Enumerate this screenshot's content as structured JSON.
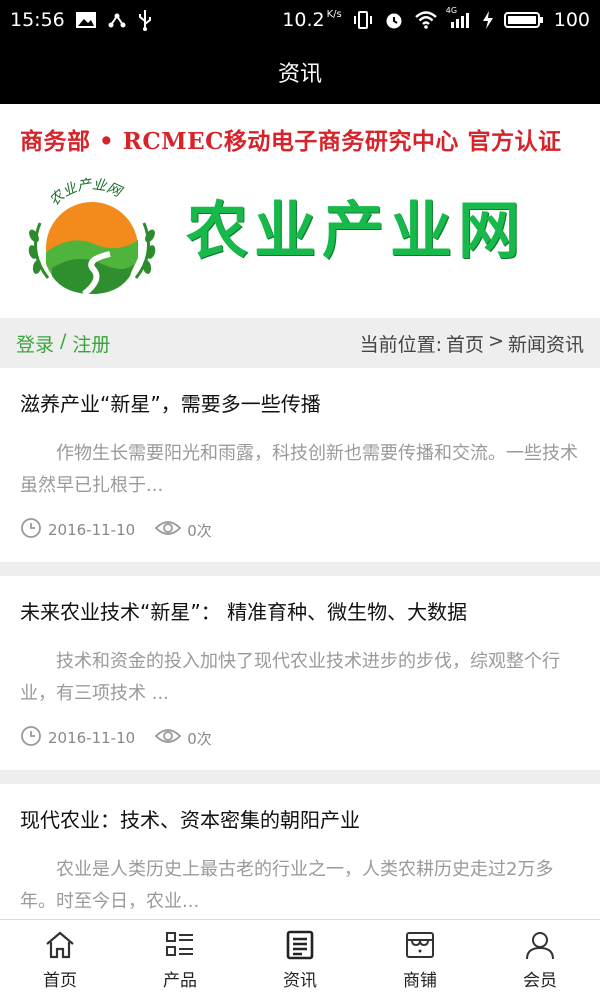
{
  "status_bar": {
    "time": "15:56",
    "speed": "10.2",
    "speed_unit": "K/s",
    "network": "4G",
    "battery": "100"
  },
  "title_bar": {
    "title": "资讯"
  },
  "banner": {
    "cert_text": "商务部 • RCMEC移动电子商务研究中心 官方认证",
    "brand": "农业产业网",
    "logo_arc_text": "农业产业网",
    "colors": {
      "cert": "#d6242a",
      "brand": "#16b94a"
    }
  },
  "location_bar": {
    "login": "登录",
    "separator": "/",
    "register": "注册",
    "prefix": "当前位置:",
    "home": "首页",
    "arrow": ">",
    "current": "新闻资讯"
  },
  "news": [
    {
      "title": "滋养产业“新星”，需要多一些传播",
      "desc": "作物生长需要阳光和雨露，科技创新也需要传播和交流。一些技术虽然早已扎根于...",
      "date": "2016-11-10",
      "views": "0次"
    },
    {
      "title": "未来农业技术“新星”： 精准育种、微生物、大数据",
      "desc": "技术和资金的投入加快了现代农业技术进步的步伐，综观整个行业，有三项技术 ...",
      "date": "2016-11-10",
      "views": "0次"
    },
    {
      "title": "现代农业：技术、资本密集的朝阳产业",
      "desc": "农业是人类历史上最古老的行业之一，人类农耕历史走过2万多年。时至今日，农业...",
      "date": "",
      "views": ""
    }
  ],
  "tabs": [
    {
      "label": "首页",
      "icon": "home-icon"
    },
    {
      "label": "产品",
      "icon": "list-icon"
    },
    {
      "label": "资讯",
      "icon": "news-icon"
    },
    {
      "label": "商铺",
      "icon": "shop-icon"
    },
    {
      "label": "会员",
      "icon": "user-icon"
    }
  ]
}
